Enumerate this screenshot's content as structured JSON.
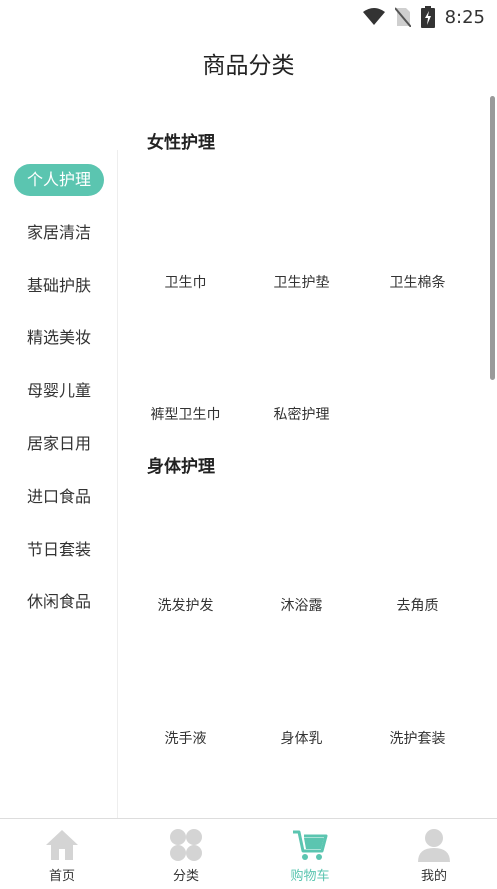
{
  "status_bar": {
    "time": "8:25"
  },
  "header": {
    "title": "商品分类"
  },
  "sidebar": {
    "items": [
      {
        "label": "个人护理",
        "active": true
      },
      {
        "label": "家居清洁"
      },
      {
        "label": "基础护肤"
      },
      {
        "label": "精选美妆"
      },
      {
        "label": "母婴儿童"
      },
      {
        "label": "居家日用"
      },
      {
        "label": "进口食品"
      },
      {
        "label": "节日套装"
      },
      {
        "label": "休闲食品"
      }
    ]
  },
  "sections": [
    {
      "title": "女性护理",
      "items": [
        "卫生巾",
        "卫生护垫",
        "卫生棉条",
        "裤型卫生巾",
        "私密护理"
      ]
    },
    {
      "title": "身体护理",
      "items": [
        "洗发护发",
        "沐浴露",
        "去角质",
        "洗手液",
        "身体乳",
        "洗护套装"
      ]
    }
  ],
  "tabbar": {
    "tabs": [
      {
        "label": "首页",
        "icon": "home-icon"
      },
      {
        "label": "分类",
        "icon": "category-icon"
      },
      {
        "label": "购物车",
        "icon": "cart-icon",
        "active": true
      },
      {
        "label": "我的",
        "icon": "user-icon"
      }
    ]
  },
  "colors": {
    "accent": "#5bc5b0",
    "icon_gray": "#d4d4d4"
  }
}
